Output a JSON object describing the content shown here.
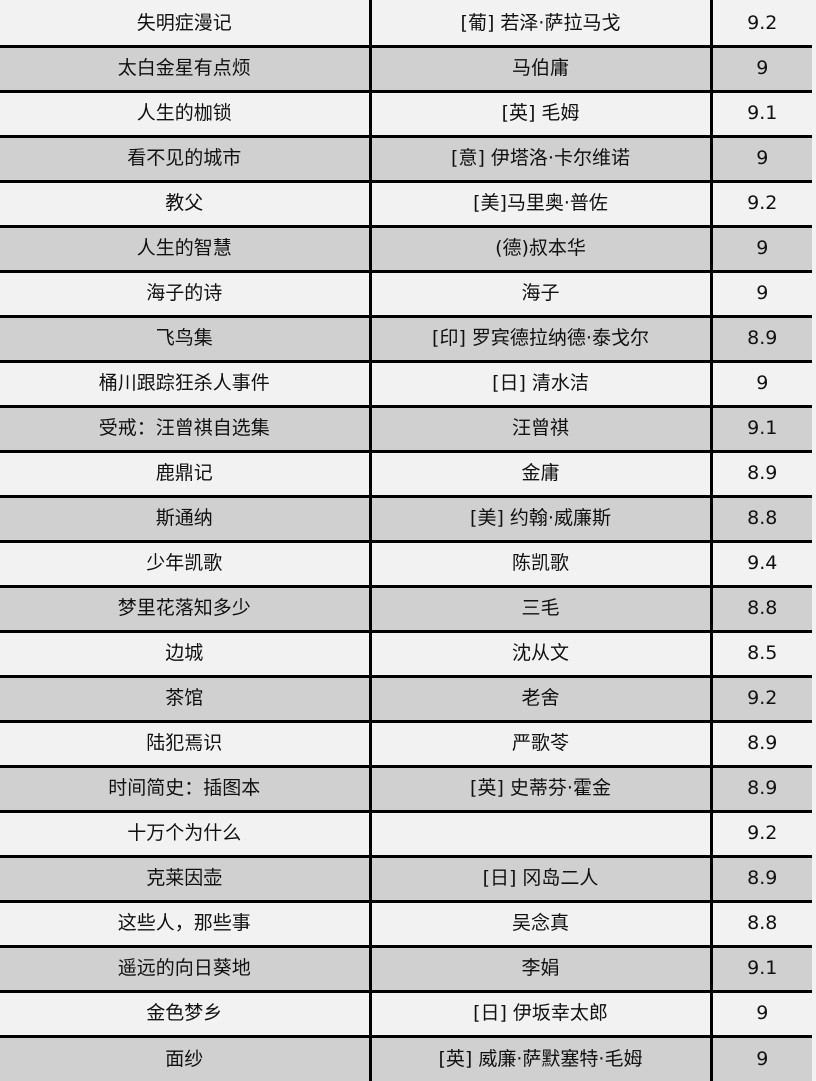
{
  "table": {
    "columns": [
      "title",
      "author",
      "rating"
    ],
    "rows": [
      {
        "title": "失明症漫记",
        "author": "[葡] 若泽·萨拉马戈",
        "rating": "9.2"
      },
      {
        "title": "太白金星有点烦",
        "author": "马伯庸",
        "rating": "9"
      },
      {
        "title": "人生的枷锁",
        "author": "[英] 毛姆",
        "rating": "9.1"
      },
      {
        "title": "看不见的城市",
        "author": "[意] 伊塔洛·卡尔维诺",
        "rating": "9"
      },
      {
        "title": "教父",
        "author": "[美]马里奥·普佐",
        "rating": "9.2"
      },
      {
        "title": "人生的智慧",
        "author": "(德)叔本华",
        "rating": "9"
      },
      {
        "title": "海子的诗",
        "author": "海子",
        "rating": "9"
      },
      {
        "title": "飞鸟集",
        "author": "[印] 罗宾德拉纳德·泰戈尔",
        "rating": "8.9"
      },
      {
        "title": "桶川跟踪狂杀人事件",
        "author": "[日] 清水洁",
        "rating": "9"
      },
      {
        "title": "受戒：汪曾祺自选集",
        "author": "汪曾祺",
        "rating": "9.1"
      },
      {
        "title": "鹿鼎记",
        "author": "金庸",
        "rating": "8.9"
      },
      {
        "title": "斯通纳",
        "author": "[美] 约翰·威廉斯",
        "rating": "8.8"
      },
      {
        "title": "少年凯歌",
        "author": "陈凯歌",
        "rating": "9.4"
      },
      {
        "title": "梦里花落知多少",
        "author": "三毛",
        "rating": "8.8"
      },
      {
        "title": "边城",
        "author": "沈从文",
        "rating": "8.5"
      },
      {
        "title": "茶馆",
        "author": "老舍",
        "rating": "9.2"
      },
      {
        "title": "陆犯焉识",
        "author": "严歌苓",
        "rating": "8.9"
      },
      {
        "title": "时间简史：插图本",
        "author": "[英] 史蒂芬·霍金",
        "rating": "8.9"
      },
      {
        "title": "十万个为什么",
        "author": "",
        "rating": "9.2"
      },
      {
        "title": "克莱因壶",
        "author": "[日] 冈岛二人",
        "rating": "8.9"
      },
      {
        "title": "这些人，那些事",
        "author": "吴念真",
        "rating": "8.8"
      },
      {
        "title": "遥远的向日葵地",
        "author": "李娟",
        "rating": "9.1"
      },
      {
        "title": "金色梦乡",
        "author": "[日] 伊坂幸太郎",
        "rating": "9"
      },
      {
        "title": "面纱",
        "author": "[英] 威廉·萨默塞特·毛姆",
        "rating": "9"
      }
    ]
  },
  "style": {
    "row_odd_background": "#f2f2f2",
    "row_even_background": "#d0d0d0",
    "border_color": "#000000",
    "text_color": "#111111"
  }
}
